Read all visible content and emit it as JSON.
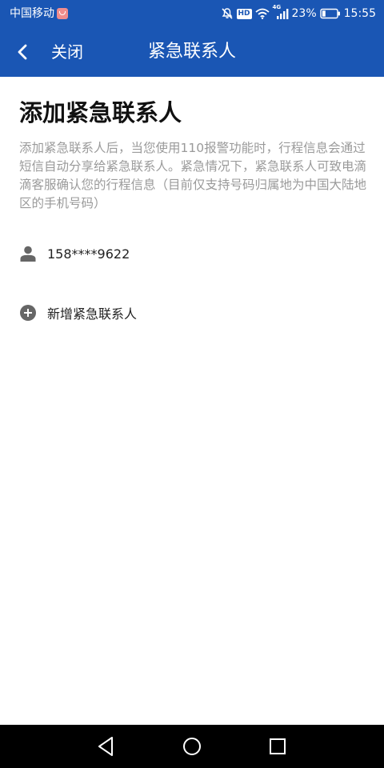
{
  "theme": {
    "header_bg": "#1a56b4",
    "nav_bg": "#000000",
    "text_primary": "#111111",
    "text_secondary": "#9a9a9a",
    "icon_color": "#666666"
  },
  "status_bar": {
    "carrier": "中国移动",
    "carrier_icon": "carrier-app-icon",
    "icons": [
      "mute-icon",
      "hd-icon",
      "wifi-icon",
      "4g-signal-icon"
    ],
    "hd_label": "HD",
    "network_label": "4G",
    "battery_percent": "23%",
    "battery_level": 0.23,
    "time": "15:55"
  },
  "header": {
    "back_icon": "chevron-left-icon",
    "back_label": "关闭",
    "title": "紧急联系人"
  },
  "main": {
    "title": "添加紧急联系人",
    "description": "添加紧急联系人后，当您使用110报警功能时，行程信息会通过短信自动分享给紧急联系人。紧急情况下，紧急联系人可致电滴滴客服确认您的行程信息（目前仅支持号码归属地为中国大陆地区的手机号码）",
    "contacts": [
      {
        "icon": "person-icon",
        "phone": "158****9622"
      }
    ],
    "add_contact": {
      "icon": "plus-circle-icon",
      "label": "新增紧急联系人"
    }
  },
  "nav_bar": {
    "buttons": [
      "back-triangle-icon",
      "home-circle-icon",
      "recents-square-icon"
    ]
  }
}
